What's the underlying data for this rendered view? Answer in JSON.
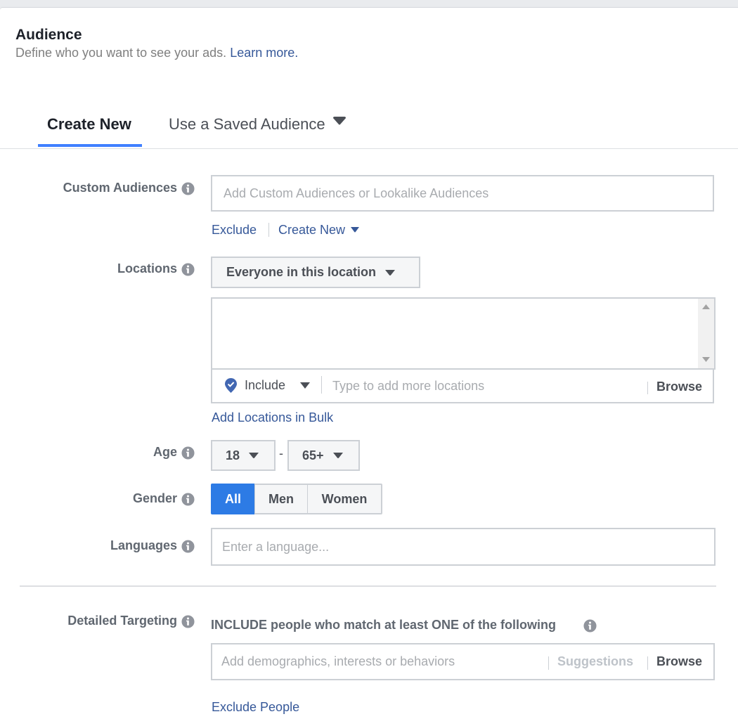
{
  "header": {
    "title": "Audience",
    "subtitle": "Define who you want to see your ads.",
    "learn_more": "Learn more."
  },
  "tabs": {
    "create_new": "Create New",
    "saved": "Use a Saved Audience"
  },
  "custom_audiences": {
    "label": "Custom Audiences",
    "placeholder": "Add Custom Audiences or Lookalike Audiences",
    "exclude": "Exclude",
    "create_new": "Create New"
  },
  "locations": {
    "label": "Locations",
    "dropdown": "Everyone in this location",
    "include": "Include",
    "placeholder": "Type to add more locations",
    "browse": "Browse",
    "add_bulk": "Add Locations in Bulk"
  },
  "age": {
    "label": "Age",
    "min": "18",
    "separator": "-",
    "max": "65+"
  },
  "gender": {
    "label": "Gender",
    "options": [
      "All",
      "Men",
      "Women"
    ],
    "selected": "All"
  },
  "languages": {
    "label": "Languages",
    "placeholder": "Enter a language..."
  },
  "detailed_targeting": {
    "label": "Detailed Targeting",
    "include_text": "INCLUDE people who match at least ONE of the following",
    "placeholder": "Add demographics, interests or behaviors",
    "suggestions": "Suggestions",
    "browse": "Browse",
    "exclude_people": "Exclude People"
  },
  "colors": {
    "accent": "#4080ff",
    "link": "#365899",
    "selected_button": "#2d7be5"
  }
}
